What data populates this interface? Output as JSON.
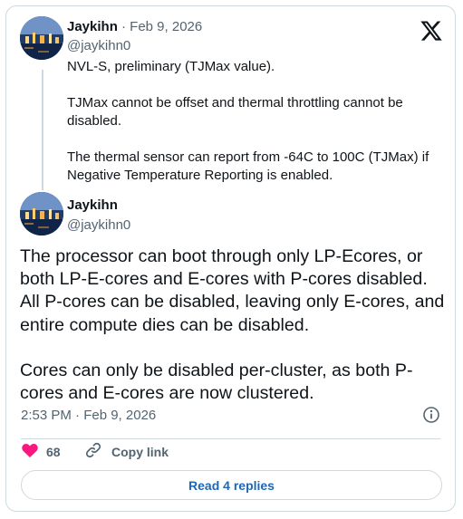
{
  "reply_tweet": {
    "author": {
      "name": "Jaykihn",
      "handle": "@jaykihn0"
    },
    "separator_date": "· Feb 9, 2026",
    "text": "NVL-S, preliminary (TJMax value).\n\nTJMax cannot be offset and thermal throttling cannot be disabled.\n\nThe thermal sensor can report from -64C to 100C (TJMax) if Negative Temperature Reporting is enabled."
  },
  "main_tweet": {
    "author": {
      "name": "Jaykihn",
      "handle": "@jaykihn0"
    },
    "text": "The processor can boot through only LP-Ecores, or both LP-E-cores and E-cores with P-cores disabled. All P-cores can be disabled, leaving only E-cores, and entire compute dies can be disabled.\n\nCores can only be disabled per-cluster, as both P-cores and E-cores are now clustered.",
    "timestamp": "2:53 PM · Feb 9, 2026",
    "likes": "68",
    "copy_link_label": "Copy link",
    "read_replies_label": "Read 4 replies"
  },
  "icons": {
    "platform_logo": "x-logo-icon",
    "info": "info-icon",
    "like": "heart-icon",
    "copy": "link-icon"
  },
  "colors": {
    "heart": "#f91880",
    "link_blue": "#1d67b8",
    "muted_text": "#536471",
    "border": "#cfd9de"
  }
}
